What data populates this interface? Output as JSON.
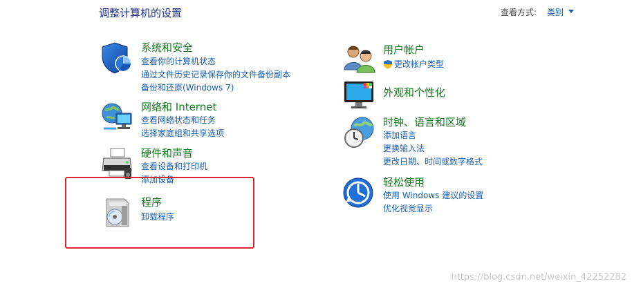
{
  "header": {
    "title": "调整计算机的设置",
    "view_by_label": "查看方式:",
    "view_by_value": "类别"
  },
  "categories_left": [
    {
      "title": "系统和安全",
      "links": [
        "查看你的计算机状态",
        "通过文件历史记录保存你的文件备份副本",
        "备份和还原(Windows 7)"
      ],
      "icon": "shield-icon"
    },
    {
      "title": "网络和 Internet",
      "links": [
        "查看网络状态和任务",
        "选择家庭组和共享选项"
      ],
      "icon": "network-globe-icon"
    },
    {
      "title": "硬件和声音",
      "links": [
        "查看设备和打印机",
        "添加设备"
      ],
      "icon": "printer-icon"
    },
    {
      "title": "程序",
      "links": [
        "卸载程序"
      ],
      "icon": "programs-disc-icon"
    }
  ],
  "categories_right": [
    {
      "title": "用户帐户",
      "links": [
        "更改帐户类型"
      ],
      "icon": "users-icon",
      "link_icon": "uac-shield-icon"
    },
    {
      "title": "外观和个性化",
      "links": [],
      "icon": "monitor-palette-icon"
    },
    {
      "title": "时钟、语言和区域",
      "links": [
        "添加语言",
        "更换输入法",
        "更改日期、时间或数字格式"
      ],
      "icon": "clock-globe-icon"
    },
    {
      "title": "轻松使用",
      "links": [
        "使用 Windows 建议的设置",
        "优化视觉显示"
      ],
      "icon": "ease-of-access-icon"
    }
  ],
  "watermark": "https://blog.csdn.net/weixin_42252282",
  "colors": {
    "title_blue": "#1e3287",
    "category_green": "#117a1c",
    "link_blue": "#1a5fb4",
    "highlight_red": "#e0252a"
  }
}
